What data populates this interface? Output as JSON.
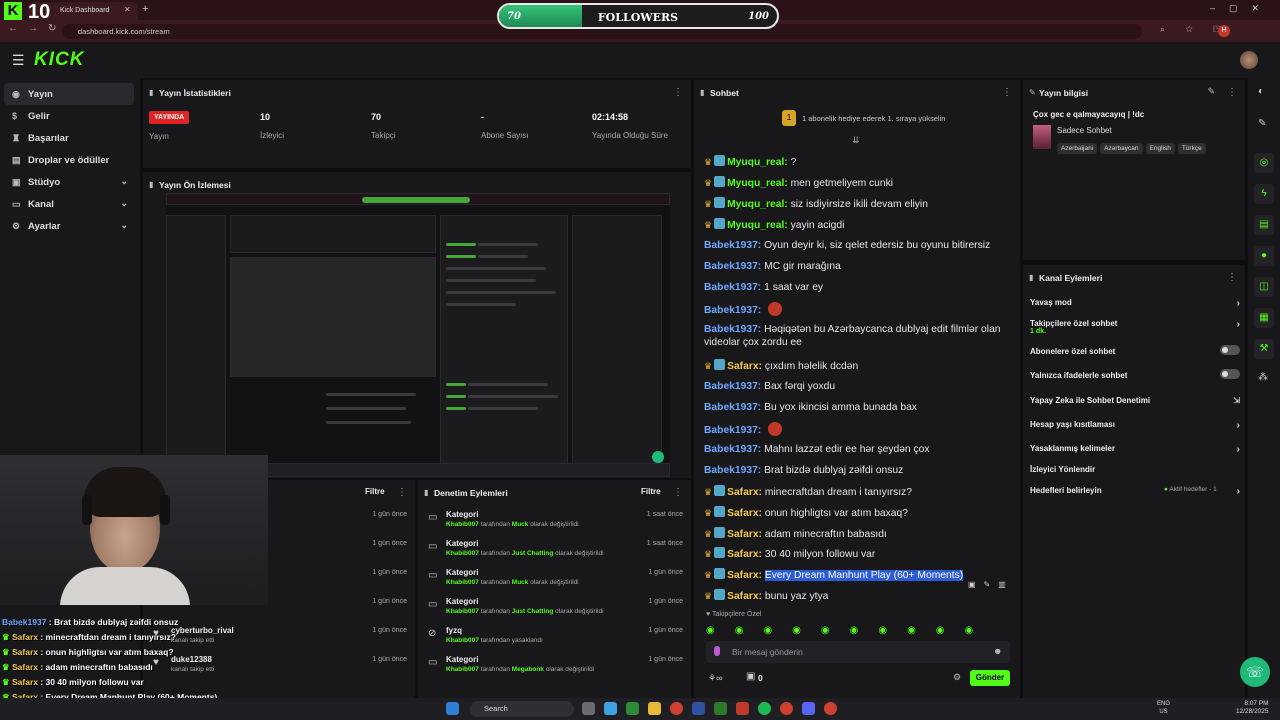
{
  "browser": {
    "tab_title": "Kick Dashboard",
    "url": "dashboard.kick.com/stream"
  },
  "overlay": {
    "viewer_badge": "K",
    "viewer_count": "10",
    "goal_min": "70",
    "goal_label": "FOLLOWERS",
    "goal_max": "100",
    "goal_progress": 0.3
  },
  "header": {
    "logo": "KICK"
  },
  "sidebar": {
    "items": [
      {
        "label": "Yayın",
        "icon": "broadcast-icon"
      },
      {
        "label": "Gelir",
        "icon": "money-icon"
      },
      {
        "label": "Başarılar",
        "icon": "trophy-icon"
      },
      {
        "label": "Droplar ve ödüller",
        "icon": "gift-icon"
      },
      {
        "label": "Stüdyo",
        "icon": "studio-icon"
      },
      {
        "label": "Kanal",
        "icon": "channel-icon"
      },
      {
        "label": "Ayarlar",
        "icon": "gear-icon"
      }
    ]
  },
  "stats": {
    "title": "Yayın İstatistikleri",
    "live_badge": "YAYINDA",
    "live_label": "Yayın",
    "viewers_value": "10",
    "viewers_label": "İzleyici",
    "followers_value": "70",
    "followers_label": "Takipçi",
    "subs_value": "-",
    "subs_label": "Abone Sayısı",
    "duration_value": "02:14:58",
    "duration_label": "Yayında Olduğu Süre"
  },
  "preview": {
    "title": "Yayın Ön İzlemesi"
  },
  "left_activity": {
    "filter": "Filtre",
    "rows": [
      {
        "title": "",
        "sub": "",
        "time": "1 gün önce"
      },
      {
        "title": "",
        "sub": "",
        "time": "1 gün önce"
      },
      {
        "title": "",
        "sub": "",
        "time": "1 gün önce"
      },
      {
        "title": "",
        "sub": "",
        "time": "1 gün önce"
      },
      {
        "title": "cyberturbo_rival",
        "sub": "kanalı takip etti",
        "time": "1 gün önce"
      },
      {
        "title": "duke12388",
        "sub": "kanalı takip etti",
        "time": "1 gün önce"
      }
    ]
  },
  "mod_actions": {
    "title": "Denetim Eylemleri",
    "filter": "Filtre",
    "rows": [
      {
        "title": "Kategori",
        "user": "Khabib007",
        "mid": "tarafından",
        "value": "Muck",
        "end": "olarak değiştirildi",
        "time": "1 saat önce"
      },
      {
        "title": "Kategori",
        "user": "Khabib007",
        "mid": "tarafından",
        "value": "Just Chatting",
        "end": "olarak değiştirildi",
        "time": "1 saat önce"
      },
      {
        "title": "Kategori",
        "user": "Khabib007",
        "mid": "tarafından",
        "value": "Muck",
        "end": "olarak değiştirildi",
        "time": "1 gün önce"
      },
      {
        "title": "Kategori",
        "user": "Khabib007",
        "mid": "tarafından",
        "value": "Just Chatting",
        "end": "olarak değiştirildi",
        "time": "1 gün önce"
      },
      {
        "title": "fyzq",
        "user": "Khabib007",
        "mid": "tarafından yasaklandı",
        "value": "",
        "end": "",
        "time": "1 gün önce"
      },
      {
        "title": "Kategori",
        "user": "Khabib007",
        "mid": "tarafından",
        "value": "Megabonk",
        "end": "olarak değiştirildi",
        "time": "1 gün önce"
      }
    ]
  },
  "chat": {
    "title": "Sohbet",
    "pinned": "1 abonelik hediye ederek 1. sıraya yükselin",
    "messages": [
      {
        "user": "Myuqu_real",
        "cls": "u-myu",
        "badges": true,
        "text": "?"
      },
      {
        "user": "Myuqu_real",
        "cls": "u-myu",
        "badges": true,
        "text": "men getmeliyem cunki"
      },
      {
        "user": "Myuqu_real",
        "cls": "u-myu",
        "badges": true,
        "text": "siz isdiyirsize ikili devam eliyin"
      },
      {
        "user": "Myuqu_real",
        "cls": "u-myu",
        "badges": true,
        "text": "yayin acigdi"
      },
      {
        "user": "Babek1937",
        "cls": "u-bab",
        "badges": false,
        "text": "Oyun deyir ki, siz qelet edersiz bu oyunu bitirersiz"
      },
      {
        "user": "Babek1937",
        "cls": "u-bab",
        "badges": false,
        "text": "MC gir marağına"
      },
      {
        "user": "Babek1937",
        "cls": "u-bab",
        "badges": false,
        "text": "1 saat var ey"
      },
      {
        "user": "Babek1937",
        "cls": "u-bab",
        "badges": false,
        "text": ""
      },
      {
        "user": "Babek1937",
        "cls": "u-bab",
        "badges": false,
        "text": "Həqiqətən bu Azərbaycanca dublyaj edit filmlər olan",
        "text2": "videolar çox zordu ee"
      },
      {
        "user": "Safarx",
        "cls": "u-saf",
        "badges": true,
        "text": "çıxdım həlelik dcdən"
      },
      {
        "user": "Babek1937",
        "cls": "u-bab",
        "badges": false,
        "text": "Bax fərqi yoxdu"
      },
      {
        "user": "Babek1937",
        "cls": "u-bab",
        "badges": false,
        "text": "Bu yox ikincisi amma bunada bax"
      },
      {
        "user": "Babek1937",
        "cls": "u-bab",
        "badges": false,
        "text": ""
      },
      {
        "user": "Babek1937",
        "cls": "u-bab",
        "badges": false,
        "text": "Mahnı lazzət edir ee hər şeydən çox"
      },
      {
        "user": "Babek1937",
        "cls": "u-bab",
        "badges": false,
        "text": "Brat bizdə dublyaj zəifdi onsuz"
      },
      {
        "user": "Safarx",
        "cls": "u-saf",
        "badges": true,
        "text": "minecraftdan dream i tanıyırsız?"
      },
      {
        "user": "Safarx",
        "cls": "u-saf",
        "badges": true,
        "text": "onun highligtsı var atım baxaq?"
      },
      {
        "user": "Safarx",
        "cls": "u-saf",
        "badges": true,
        "text": "adam minecraftın babasıdı"
      },
      {
        "user": "Safarx",
        "cls": "u-saf",
        "badges": true,
        "text": "30 40 milyon followu var"
      },
      {
        "user": "Safarx",
        "cls": "u-saf",
        "badges": true,
        "text": "Every Dream Manhunt Play (60+ Moments)",
        "highlight": true
      },
      {
        "user": "Safarx",
        "cls": "u-saf",
        "badges": true,
        "text": "bunu yaz ytya"
      }
    ],
    "followers_only": "Takipçilere Özel",
    "input_placeholder": "Bir mesaj gönderin",
    "points": "0",
    "send": "Gönder"
  },
  "stream_info": {
    "title": "Yayın bilgisi",
    "stream_title": "Çox gec e qalmayacayıq | !dc",
    "category": "Sadece Sohbet",
    "tags": [
      "Azerbaijani",
      "Azərbaycan",
      "English",
      "Türkçe"
    ]
  },
  "channel_actions": {
    "title": "Kanal Eylemleri",
    "rows": [
      {
        "label": "Yavaş mod",
        "type": "chevron"
      },
      {
        "label": "Takipçilere özel sohbet",
        "sub": "1 dk.",
        "type": "chevron"
      },
      {
        "label": "Abonelere özel sohbet",
        "type": "toggle"
      },
      {
        "label": "Yalnızca ifadelerle sohbet",
        "type": "toggle"
      },
      {
        "label": "Yapay Zeka ile Sohbet Denetimi",
        "type": "external"
      },
      {
        "label": "Hesap yaşı kısıtlaması",
        "type": "chevron"
      },
      {
        "label": "Yasaklanmış kelimeler",
        "type": "chevron"
      },
      {
        "label": "İzleyici Yönlendir",
        "type": "none"
      },
      {
        "label": "Hedefleri belirleyin",
        "type": "chevron",
        "status": "Aktif hedefler - 1"
      }
    ]
  },
  "overlay_chat": [
    {
      "user": "Babek1937",
      "cls": "n-b",
      "text": "Brat bizdə dublyaj zəifdi onsuz"
    },
    {
      "user": "Safarx",
      "cls": "n-s",
      "text": "minecraftdan dream i tanıyırsız?"
    },
    {
      "user": "Safarx",
      "cls": "n-s",
      "text": "onun highligtsı var atım baxaq?"
    },
    {
      "user": "Safarx",
      "cls": "n-s",
      "text": "adam minecraftın babasıdı"
    },
    {
      "user": "Safarx",
      "cls": "n-s",
      "text": "30 40 milyon followu var"
    },
    {
      "user": "Safarx",
      "cls": "n-s",
      "text": "Every Dream Manhunt Play (60+ Moments)"
    },
    {
      "user": "Safarx",
      "cls": "n-s",
      "text": "bunu yaz ytya"
    }
  ],
  "taskbar": {
    "search": "Search",
    "lang_top": "ENG",
    "lang_bottom": "US",
    "time": "8:07 PM",
    "date": "12/28/2025"
  }
}
